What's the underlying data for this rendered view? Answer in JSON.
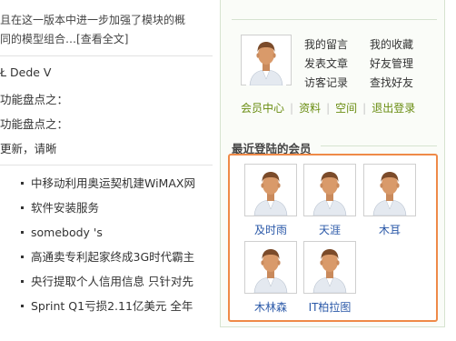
{
  "article": {
    "intro_line1": "且在这一版本中进一步加强了模块的概",
    "intro_line2": "同的模型组合…",
    "read_more": "[查看全文]",
    "lines": [
      "Ł Dede V",
      "功能盘点之：",
      "功能盘点之：",
      "更新，请晰"
    ]
  },
  "news": {
    "items": [
      "中移动利用奥运契机建WiMAX网",
      "软件安装服务",
      "somebody 's",
      "高通卖专利起家终成3G时代霸主",
      "央行提取个人信用信息 只针对先",
      "Sprint Q1亏损2.11亿美元 全年"
    ]
  },
  "member_panel": {
    "menu": [
      "我的留言",
      "我的收藏",
      "发表文章",
      "好友管理",
      "访客记录",
      "查找好友"
    ],
    "user_links": [
      "会员中心",
      "资料",
      "空间",
      "退出登录"
    ]
  },
  "recent_members": {
    "title": "最近登陆的会员",
    "members": [
      "及时雨",
      "天涯",
      "木耳",
      "木林森",
      "IT柏拉图"
    ]
  },
  "colors": {
    "link_green": "#6a8d12",
    "member_blue": "#2a58a8",
    "highlight_orange": "#ef8a48",
    "panel_border": "#d6e3d0"
  },
  "icons": {
    "avatar": "default-user-avatar-icon",
    "bullet": "square-bullet-icon"
  }
}
